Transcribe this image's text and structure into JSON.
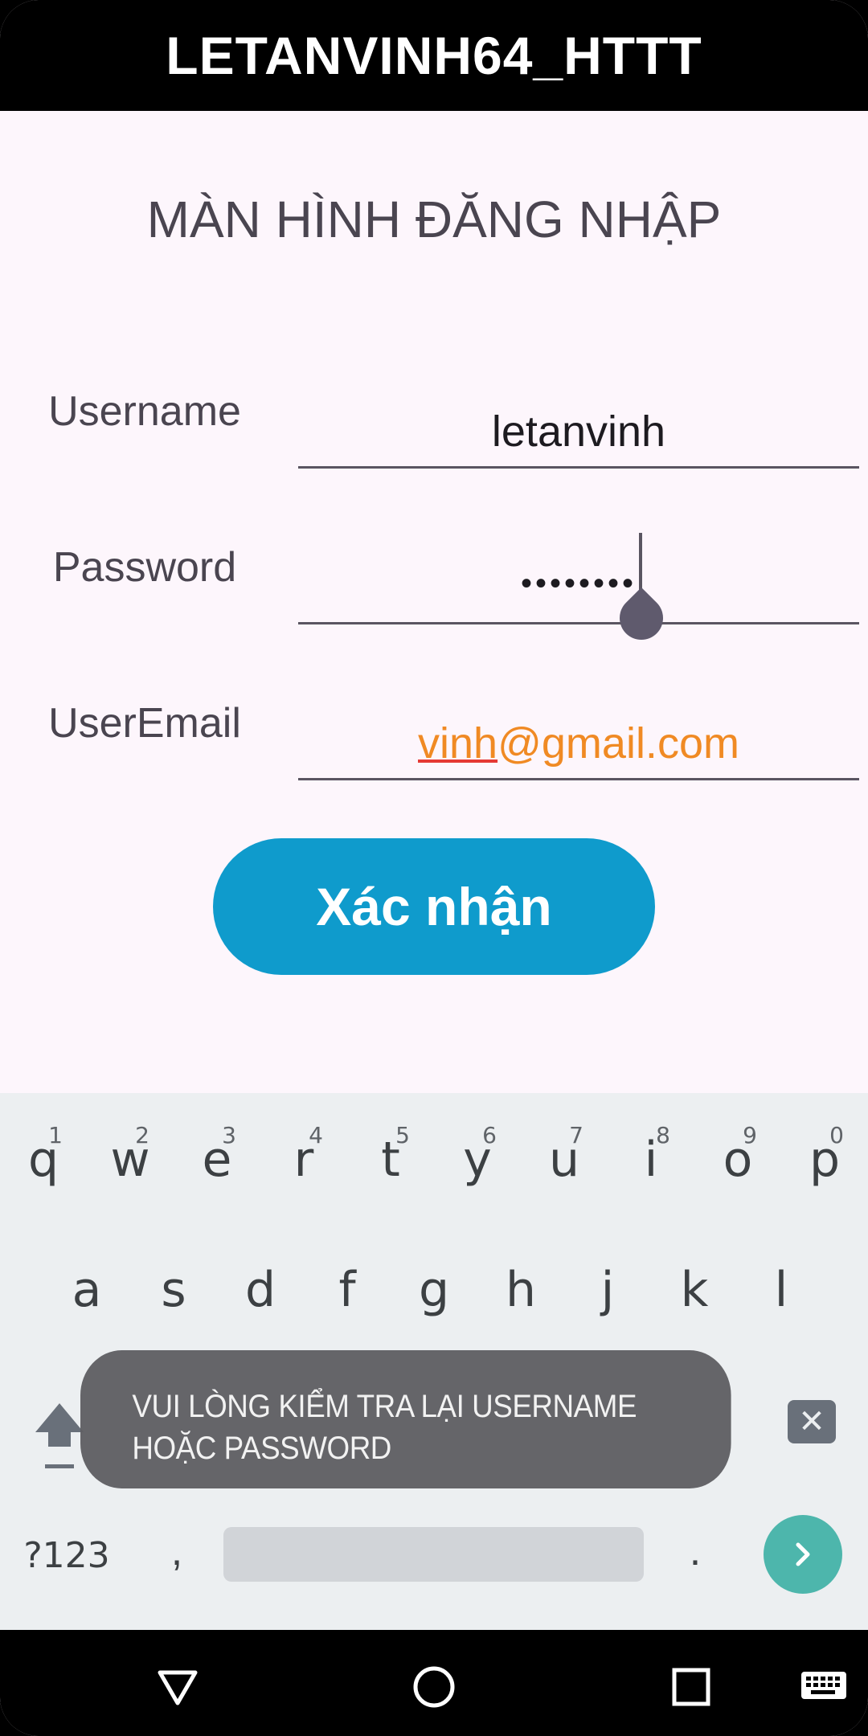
{
  "app": {
    "title": "LETANVINH64_HTTT"
  },
  "login": {
    "title": "MÀN HÌNH ĐĂNG NHẬP",
    "username_label": "Username",
    "username_value": "letanvinh",
    "password_label": "Password",
    "password_value": "••••••••",
    "email_label": "UserEmail",
    "email_value_part1": "vinh",
    "email_value_part2": "@gmail.com",
    "confirm_label": "Xác nhận"
  },
  "keyboard": {
    "row1": [
      {
        "key": "q",
        "hint": "1"
      },
      {
        "key": "w",
        "hint": "2"
      },
      {
        "key": "e",
        "hint": "3"
      },
      {
        "key": "r",
        "hint": "4"
      },
      {
        "key": "t",
        "hint": "5"
      },
      {
        "key": "y",
        "hint": "6"
      },
      {
        "key": "u",
        "hint": "7"
      },
      {
        "key": "i",
        "hint": "8"
      },
      {
        "key": "o",
        "hint": "9"
      },
      {
        "key": "p",
        "hint": "0"
      }
    ],
    "row2": [
      "a",
      "s",
      "d",
      "f",
      "g",
      "h",
      "j",
      "k",
      "l"
    ],
    "symbols_label": "?123",
    "comma_label": ",",
    "period_label": "."
  },
  "toast": {
    "message": "VUI LÒNG KIỂM TRA LẠI USERNAME HOẶC PASSWORD"
  },
  "icons": {
    "shift": "shift-icon",
    "backspace": "backspace-icon",
    "go": "arrow-right-icon",
    "back": "nav-back-icon",
    "home": "nav-home-icon",
    "recents": "nav-recents-icon",
    "keyboard": "keyboard-icon"
  },
  "colors": {
    "accent": "#0f9bcc",
    "email_text": "#f08a24",
    "go_key": "#4db6ac"
  }
}
